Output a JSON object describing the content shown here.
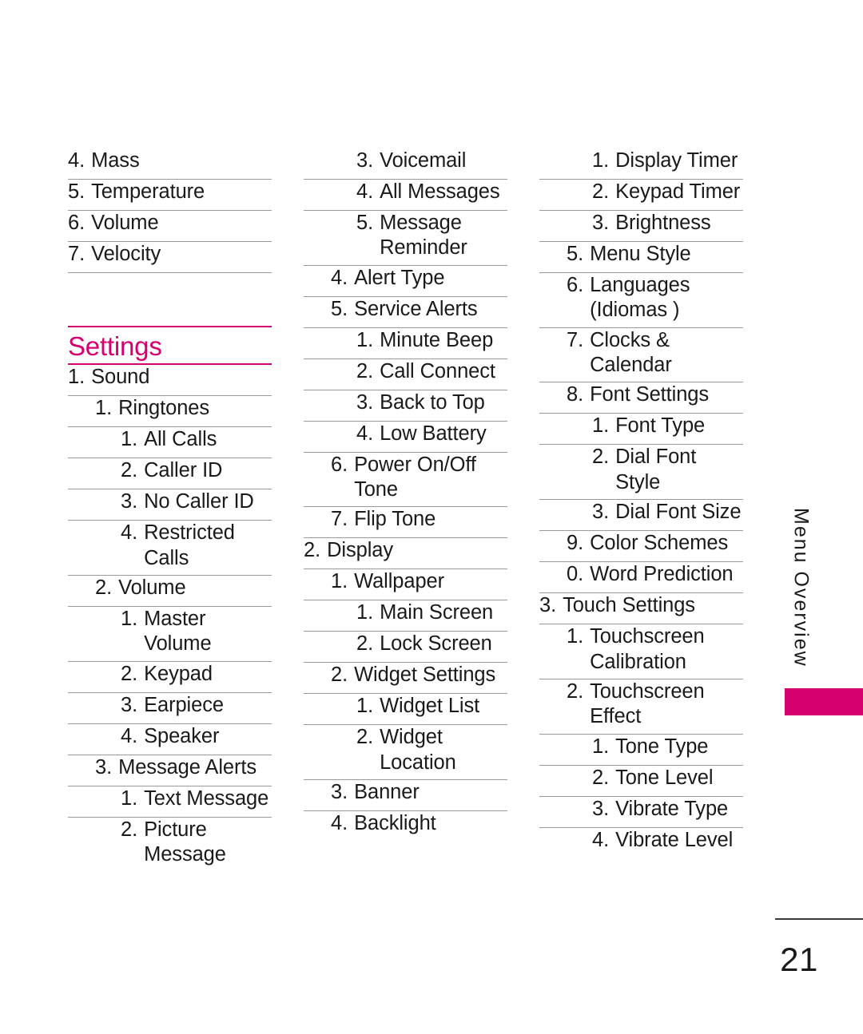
{
  "page": {
    "number": "21",
    "side_tab_label": "Menu Overview",
    "accent_color": "#d6006e",
    "rule_color": "#9a9a9a"
  },
  "columns": [
    {
      "id": "column-1",
      "rows": [
        {
          "kind": "item",
          "level": 1,
          "num": "4.",
          "label": "Mass"
        },
        {
          "kind": "item",
          "level": 1,
          "num": "5.",
          "label": "Temperature"
        },
        {
          "kind": "item",
          "level": 1,
          "num": "6.",
          "label": "Volume"
        },
        {
          "kind": "item",
          "level": 1,
          "num": "7.",
          "label": "Velocity"
        },
        {
          "kind": "blank"
        },
        {
          "kind": "heading",
          "title": "Settings"
        },
        {
          "kind": "item",
          "level": 1,
          "num": "1.",
          "label": "Sound"
        },
        {
          "kind": "item",
          "level": 2,
          "num": "1.",
          "label": "Ringtones"
        },
        {
          "kind": "item",
          "level": 3,
          "num": "1.",
          "label": "All Calls"
        },
        {
          "kind": "item",
          "level": 3,
          "num": "2.",
          "label": "Caller ID"
        },
        {
          "kind": "item",
          "level": 3,
          "num": "3.",
          "label": "No Caller ID"
        },
        {
          "kind": "item",
          "level": 3,
          "num": "4.",
          "label": "Restricted Calls"
        },
        {
          "kind": "item",
          "level": 2,
          "num": "2.",
          "label": "Volume"
        },
        {
          "kind": "item",
          "level": 3,
          "num": "1.",
          "label": "Master Volume"
        },
        {
          "kind": "item",
          "level": 3,
          "num": "2.",
          "label": "Keypad"
        },
        {
          "kind": "item",
          "level": 3,
          "num": "3.",
          "label": "Earpiece"
        },
        {
          "kind": "item",
          "level": 3,
          "num": "4.",
          "label": "Speaker"
        },
        {
          "kind": "item",
          "level": 2,
          "num": "3.",
          "label": "Message Alerts"
        },
        {
          "kind": "item",
          "level": 3,
          "num": "1.",
          "label": "Text Message"
        },
        {
          "kind": "item",
          "level": 3,
          "num": "2.",
          "label": "Picture Message",
          "last": true
        }
      ]
    },
    {
      "id": "column-2",
      "rows": [
        {
          "kind": "item",
          "level": 3,
          "num": "3.",
          "label": "Voicemail"
        },
        {
          "kind": "item",
          "level": 3,
          "num": "4.",
          "label": "All Messages"
        },
        {
          "kind": "item",
          "level": 3,
          "num": "5.",
          "label": "Message Reminder"
        },
        {
          "kind": "item",
          "level": 2,
          "num": "4.",
          "label": "Alert Type"
        },
        {
          "kind": "item",
          "level": 2,
          "num": "5.",
          "label": "Service Alerts"
        },
        {
          "kind": "item",
          "level": 3,
          "num": "1.",
          "label": "Minute Beep"
        },
        {
          "kind": "item",
          "level": 3,
          "num": "2.",
          "label": "Call Connect"
        },
        {
          "kind": "item",
          "level": 3,
          "num": "3.",
          "label": "Back to Top"
        },
        {
          "kind": "item",
          "level": 3,
          "num": "4.",
          "label": "Low Battery"
        },
        {
          "kind": "item",
          "level": 2,
          "num": "6.",
          "label": "Power On/Off Tone"
        },
        {
          "kind": "item",
          "level": 2,
          "num": "7.",
          "label": "Flip Tone"
        },
        {
          "kind": "item",
          "level": 1,
          "num": "2.",
          "label": "Display"
        },
        {
          "kind": "item",
          "level": 2,
          "num": "1.",
          "label": "Wallpaper"
        },
        {
          "kind": "item",
          "level": 3,
          "num": "1.",
          "label": "Main Screen"
        },
        {
          "kind": "item",
          "level": 3,
          "num": "2.",
          "label": "Lock Screen"
        },
        {
          "kind": "item",
          "level": 2,
          "num": "2.",
          "label": "Widget Settings"
        },
        {
          "kind": "item",
          "level": 3,
          "num": "1.",
          "label": "Widget List"
        },
        {
          "kind": "item",
          "level": 3,
          "num": "2.",
          "label": "Widget Location"
        },
        {
          "kind": "item",
          "level": 2,
          "num": "3.",
          "label": "Banner"
        },
        {
          "kind": "item",
          "level": 2,
          "num": "4.",
          "label": "Backlight",
          "last": true
        }
      ]
    },
    {
      "id": "column-3",
      "rows": [
        {
          "kind": "item",
          "level": 3,
          "num": "1.",
          "label": "Display Timer"
        },
        {
          "kind": "item",
          "level": 3,
          "num": "2.",
          "label": "Keypad Timer"
        },
        {
          "kind": "item",
          "level": 3,
          "num": "3.",
          "label": "Brightness"
        },
        {
          "kind": "item",
          "level": 2,
          "num": "5.",
          "label": "Menu Style"
        },
        {
          "kind": "item",
          "level": 2,
          "num": "6.",
          "label": "Languages (Idiomas )"
        },
        {
          "kind": "item",
          "level": 2,
          "num": "7.",
          "label": "Clocks & Calendar"
        },
        {
          "kind": "item",
          "level": 2,
          "num": "8.",
          "label": "Font Settings"
        },
        {
          "kind": "item",
          "level": 3,
          "num": "1.",
          "label": "Font Type"
        },
        {
          "kind": "item",
          "level": 3,
          "num": "2.",
          "label": "Dial Font Style"
        },
        {
          "kind": "item",
          "level": 3,
          "num": "3.",
          "label": "Dial Font Size"
        },
        {
          "kind": "item",
          "level": 2,
          "num": "9.",
          "label": "Color Schemes"
        },
        {
          "kind": "item",
          "level": 2,
          "num": "0.",
          "label": "Word Prediction"
        },
        {
          "kind": "item",
          "level": 1,
          "num": "3.",
          "label": "Touch Settings"
        },
        {
          "kind": "item",
          "level": 2,
          "num": "1.",
          "label": "Touchscreen Calibration"
        },
        {
          "kind": "item",
          "level": 2,
          "num": "2.",
          "label": "Touchscreen Effect"
        },
        {
          "kind": "item",
          "level": 3,
          "num": "1.",
          "label": "Tone Type"
        },
        {
          "kind": "item",
          "level": 3,
          "num": "2.",
          "label": "Tone Level"
        },
        {
          "kind": "item",
          "level": 3,
          "num": "3.",
          "label": "Vibrate Type"
        },
        {
          "kind": "item",
          "level": 3,
          "num": "4.",
          "label": "Vibrate Level",
          "last": true
        }
      ]
    }
  ]
}
